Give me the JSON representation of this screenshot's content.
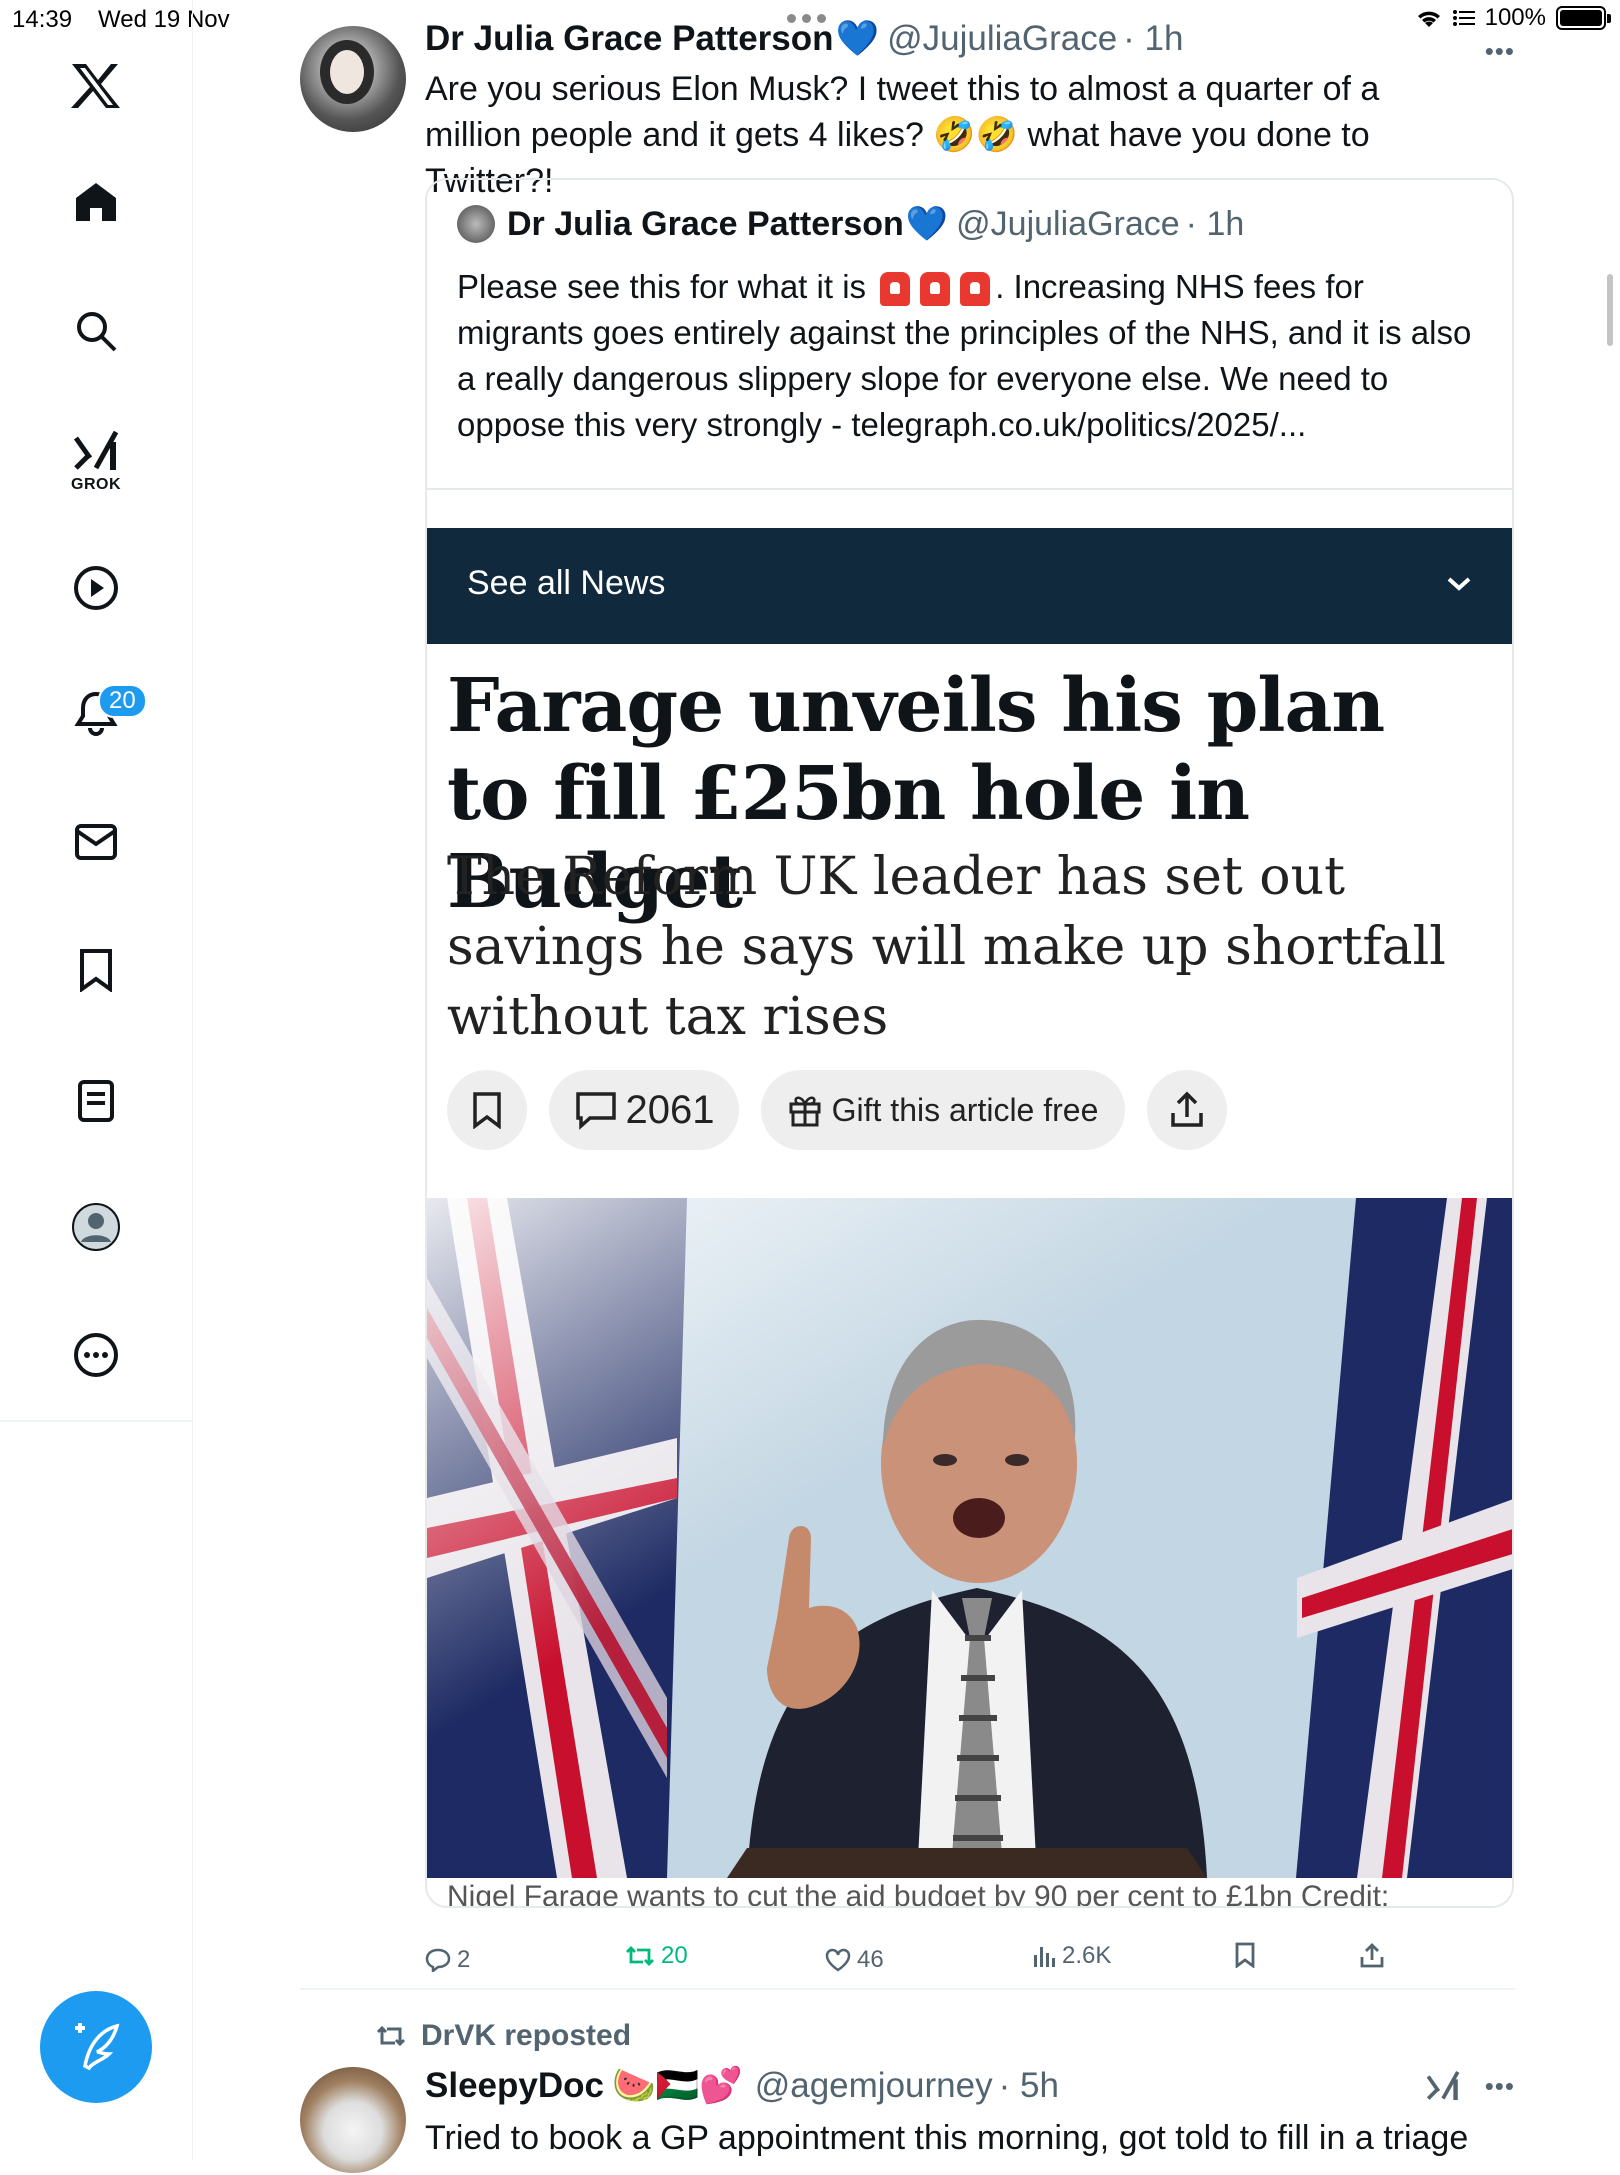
{
  "status_bar": {
    "time": "14:39",
    "date": "Wed 19 Nov",
    "battery": "100%"
  },
  "sidebar": {
    "items": [
      {
        "icon": "x-logo-icon"
      },
      {
        "icon": "home-icon"
      },
      {
        "icon": "search-icon"
      },
      {
        "icon": "grok-icon",
        "label": "GROK"
      },
      {
        "icon": "video-icon"
      },
      {
        "icon": "notifications-icon",
        "badge": "20"
      },
      {
        "icon": "messages-icon"
      },
      {
        "icon": "bookmarks-icon"
      },
      {
        "icon": "lists-icon"
      },
      {
        "icon": "profile-icon"
      },
      {
        "icon": "more-icon"
      }
    ],
    "compose_icon": "compose-post-icon"
  },
  "tweet": {
    "name": "Dr Julia Grace Patterson",
    "badge_icon": "blue-heart",
    "handle": "@JujuliaGrace",
    "time": "· 1h",
    "text": "Are you serious Elon Musk? I tweet this to almost a quarter of a million people and it gets 4 likes? 🤣🤣 what have you done to Twitter?!",
    "quote": {
      "name": "Dr Julia Grace Patterson",
      "handle": "@JujuliaGrace",
      "time": "· 1h",
      "text_before": "Please see this for what it is",
      "text_after": ". Increasing NHS fees for migrants goes entirely against the principles of the NHS, and it is also a really dangerous slippery slope for everyone else. We need to oppose this very strongly - telegraph.co.uk/politics/2025/...",
      "news_bar": "See all News",
      "headline": "Farage unveils his plan to fill £25bn hole in Budget",
      "standfirst": "The Reform UK leader has set out savings he says will make up shortfall without tax rises",
      "comment_count": "2061",
      "gift_label": "Gift this article free",
      "caption": "Nigel Farage wants to cut the aid budget by 90 per cent to £1bn  Credit:"
    },
    "stats": {
      "replies": "2",
      "reposts": "20",
      "likes": "46",
      "views": "2.6K"
    }
  },
  "tweet2": {
    "repost_label": "DrVK reposted",
    "name": "SleepyDoc",
    "emojis": "🍉🇵🇸💕",
    "handle": "@agemjourney",
    "time": "· 5h",
    "text": "Tried to book a GP appointment this morning, got told to fill in a triage"
  },
  "colors": {
    "accent": "#1d9bf0",
    "news_bar": "#10293d",
    "repost_green": "#00ba7c"
  }
}
